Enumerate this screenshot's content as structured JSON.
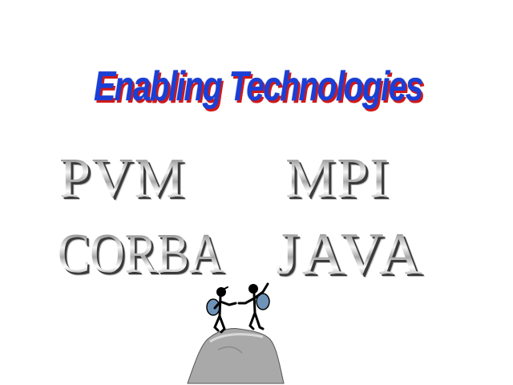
{
  "slide": {
    "title": "Enabling Technologies",
    "technologies": [
      "PVM",
      "MPI",
      "CORBA",
      "JAVA"
    ],
    "illustration": "hikers-handshake-on-summit-clipart"
  },
  "colors": {
    "title_fill": "#1a3fd6",
    "title_shadow": "#d01818",
    "chrome_dark": "#5a5a5a",
    "chrome_light": "#f4f4f4",
    "mountain": "#a9a9a9"
  }
}
